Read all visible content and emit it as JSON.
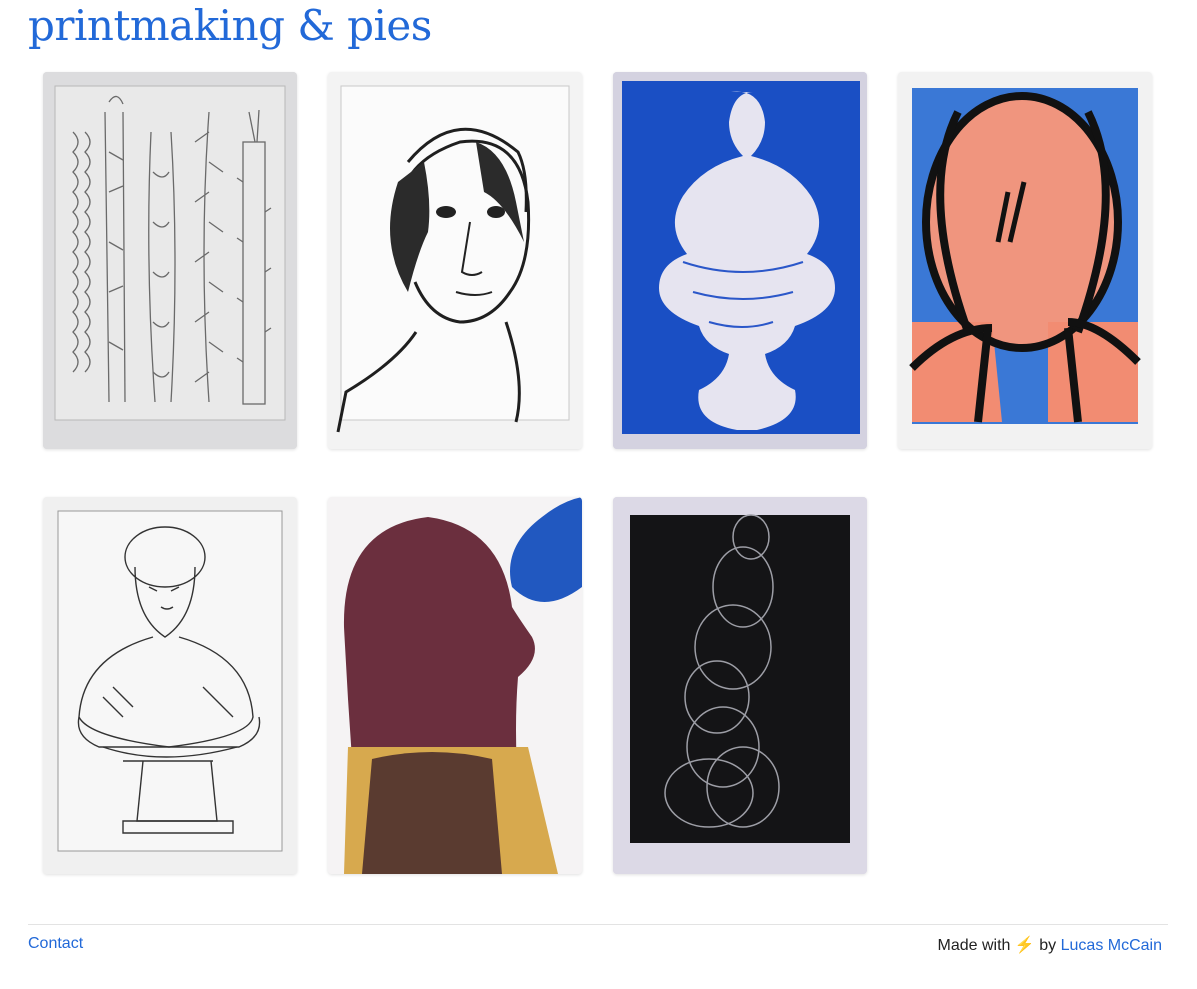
{
  "site": {
    "title": "printmaking & pies"
  },
  "gallery": {
    "items": [
      {
        "subject": "botanical-stalks-etching",
        "palette": "grey"
      },
      {
        "subject": "woman-portrait-etching",
        "palette": "black-white"
      },
      {
        "subject": "blue-bust-aquatint",
        "palette": "blue"
      },
      {
        "subject": "orange-figure-print",
        "palette": "orange-blue-black"
      },
      {
        "subject": "classical-bust-etching",
        "palette": "grey"
      },
      {
        "subject": "maroon-head-monoprint",
        "palette": "maroon-ochre-blue"
      },
      {
        "subject": "black-circles-print",
        "palette": "black"
      }
    ]
  },
  "footer": {
    "contact_label": "Contact",
    "made_with_label": "Made with",
    "bolt_icon": "⚡",
    "by_label": "by",
    "author_name": "Lucas McCain"
  },
  "colors": {
    "accent": "#2269d8",
    "bolt": "#f5b400"
  }
}
